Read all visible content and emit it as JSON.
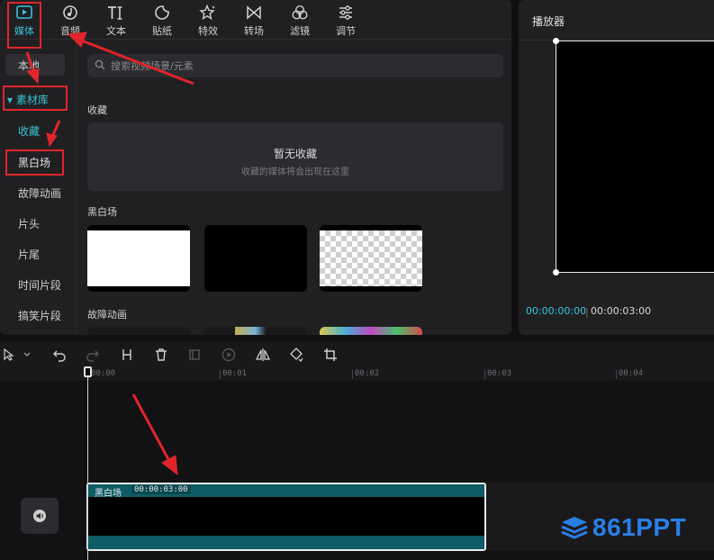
{
  "toolbar_tabs": [
    {
      "label": "媒体",
      "icon": "media-icon"
    },
    {
      "label": "音频",
      "icon": "audio-icon"
    },
    {
      "label": "文本",
      "icon": "text-icon"
    },
    {
      "label": "贴纸",
      "icon": "sticker-icon"
    },
    {
      "label": "特效",
      "icon": "effects-icon"
    },
    {
      "label": "转场",
      "icon": "transition-icon"
    },
    {
      "label": "滤镜",
      "icon": "filter-icon"
    },
    {
      "label": "调节",
      "icon": "adjust-icon"
    }
  ],
  "sidebar": {
    "local": "本地",
    "library": "▾ 素材库",
    "items": [
      "收藏",
      "黑白场",
      "故障动画",
      "片头",
      "片尾",
      "时间片段",
      "搞笑片段"
    ]
  },
  "search": {
    "placeholder": "搜索视频场景/元素"
  },
  "favorites": {
    "title": "收藏",
    "empty_title": "暂无收藏",
    "empty_hint": "收藏的媒体将会出现在这里"
  },
  "sections": {
    "black_white": "黑白场",
    "glitch": "故障动画"
  },
  "player": {
    "title": "播放器",
    "current_time": "00:00:00:00",
    "divider": "|",
    "total_time": "00:00:03:00"
  },
  "ruler": [
    "00:00",
    "00:01",
    "00:02",
    "00:03",
    "00:04"
  ],
  "clip": {
    "name": "黑白场",
    "duration": "00:00:03:00"
  },
  "watermark": "861PPT",
  "colors": {
    "accent": "#38c4d6",
    "annotation": "#e0252b",
    "clip": "#0e5c66",
    "watermark": "#2a7fe6"
  }
}
